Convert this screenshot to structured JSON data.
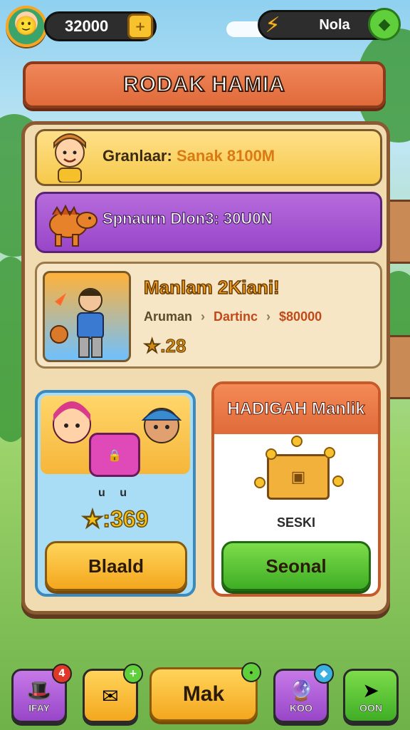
{
  "topbar": {
    "coins": "32000",
    "right_label": "Nola",
    "coin_icon": "coin-box-icon",
    "bolt_icon": "lightning-bolt-icon",
    "gem_icon": "green-gem-icon"
  },
  "title": "RODAK HAMIA",
  "rows": [
    {
      "text_prefix": "Granlaar: ",
      "text_highlight": "Sanak 8100M",
      "icon": "boy-avatar-icon"
    },
    {
      "text": "Spnaurn Dlon3: 30U0N",
      "icon": "dino-icon"
    }
  ],
  "featured": {
    "title": "Manlam 2Kiani!",
    "meta_a": "Aruman",
    "meta_arrow": "›",
    "meta_b": "Dartinc",
    "meta_c": "$80000",
    "rating": "★.28"
  },
  "card_left": {
    "sub": "u u",
    "value": "★:369",
    "button": "Blaald"
  },
  "card_right": {
    "header": "HADIGAH Manlik",
    "sub": "SESKI",
    "button": "Seonal"
  },
  "nav": {
    "items": [
      {
        "label": "IFAY",
        "badge": "4",
        "icon": "hat-icon"
      },
      {
        "label": "",
        "badge": "+",
        "icon": "envelope-icon"
      },
      {
        "label": "Mak",
        "badge": "",
        "icon": ""
      },
      {
        "label": "KOO",
        "badge": "",
        "icon": "gem-orb-icon"
      },
      {
        "label": "OON",
        "badge": "",
        "icon": "share-arrow-icon"
      }
    ]
  },
  "colors": {
    "accent_orange": "#e06a3a",
    "panel": "#f1dcb2",
    "purple": "#9846c8",
    "green": "#3fae25",
    "yellow": "#f4a71e"
  }
}
